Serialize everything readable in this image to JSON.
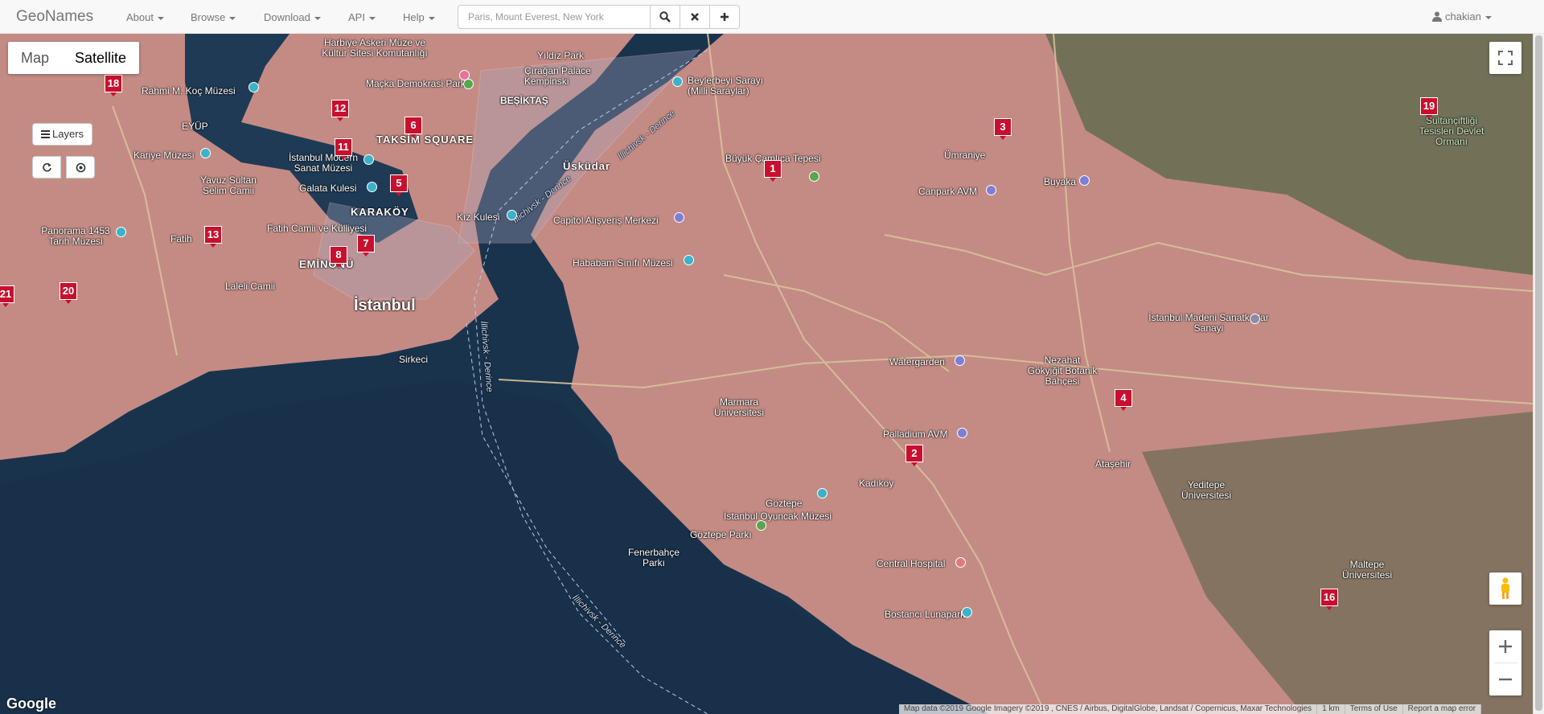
{
  "navbar": {
    "brand": "GeoNames",
    "menus": [
      {
        "label": "About"
      },
      {
        "label": "Browse"
      },
      {
        "label": "Download"
      },
      {
        "label": "API"
      },
      {
        "label": "Help"
      }
    ],
    "search_placeholder": "Paris, Mount Everest, New York",
    "user": "chakian"
  },
  "map": {
    "type_buttons": [
      "Map",
      "Satellite"
    ],
    "active_type": "Satellite",
    "layers_label": "Layers",
    "markers": [
      {
        "label": "1"
      },
      {
        "label": "2"
      },
      {
        "label": "3"
      },
      {
        "label": "4"
      },
      {
        "label": "5"
      },
      {
        "label": "6"
      },
      {
        "label": "7"
      },
      {
        "label": "8"
      },
      {
        "label": "11"
      },
      {
        "label": "12"
      },
      {
        "label": "13"
      },
      {
        "label": "16"
      },
      {
        "label": "18"
      },
      {
        "label": "19"
      },
      {
        "label": "20"
      },
      {
        "label": "21"
      }
    ],
    "place_labels": {
      "istanbul": "İstanbul",
      "uskudar": "Üsküdar",
      "karakoy": "KARAKÖY",
      "eminonu": "EMİNÖNÜ",
      "besiktas": "BEŞİKTAŞ",
      "eyup": "EYÜP",
      "kadikoy": "Kadıköy",
      "sirkeci": "Sirkeci",
      "atasehir": "Ataşehir",
      "umraniye": "Ümraniye",
      "buyaka": "Buyaka",
      "fatih": "Fatih",
      "laleli": "Laleli Camii",
      "kiz_kulesi": "Kız Kulesi",
      "goztepe": "Göztepe",
      "taksim": "TAKSİM SQUARE",
      "yildiz_park": "Yıldız Park"
    },
    "poi_labels": {
      "ciragan": "Çırağan Palace Kempinski",
      "beylerbeyi": "Beylerbeyi Sarayı (Milli Saraylar)",
      "harbiye": "Harbiye Askeri Müze ve Kültür Sitesi Komutanlığı",
      "macka": "Maçka Demokrasi Parkı",
      "rahmi": "Rahmi M. Koç Müzesi",
      "kariye": "Kariye Müzesi",
      "yavuz": "Yavuz Sultan Selim Camii",
      "panorama": "Panorama 1453 Tarih Müzesi",
      "fatih_camii": "Fatih Camii ve Külliyesi",
      "galata": "Galata Kulesi",
      "istanbul_modern": "İstanbul Modern Sanat Müzesi",
      "buyuk_camlica": "Büyük Çamlıca Tepesi",
      "capitol": "Capitol Alışveriş Merkezi",
      "hababam": "Hababam Sınıfı Müzesi",
      "canpark": "Canpark AVM",
      "watergarden": "Watergarden",
      "nezahat": "Nezahat Gökyiğit Botanik Bahçesi",
      "marmara": "Marmara Üniversitesi",
      "palladium": "Palladium AVM",
      "goztepe_parki": "Göztepe Parkı",
      "fenerbahce": "Fenerbahçe Parkı",
      "oyuncak": "İstanbul Oyuncak Müzesi",
      "central": "Central Hospital",
      "bostanci": "Bostancı Lunapark",
      "yeditepe": "Yeditepe Üniversitesi",
      "maltepe": "Maltepe Üniversitesi",
      "madeni": "İstanbul Madeni Sanatkarlar Sanayi",
      "sultanciftligi": "Sultançiftliği Tesisleri Devlet Ormanı"
    },
    "water_labels": {
      "il1": "İllichivsk - Derince",
      "il2": "İllichivsk - Derince",
      "il3": "İllichivsk - Derince",
      "il4": "İllichivsk - Derince"
    },
    "google": "Google",
    "attribution": [
      "Map data ©2019 Google Imagery ©2019 , CNES / Airbus, DigitalGlobe, Landsat / Copernicus, Maxar Technologies",
      "1 km",
      "Terms of Use",
      "Report a map error"
    ]
  },
  "colors": {
    "marker": "#c8102e",
    "land": "#c98f88",
    "water": "#1e3550"
  }
}
